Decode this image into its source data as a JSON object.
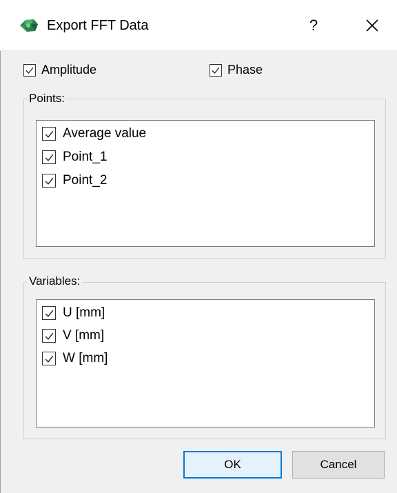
{
  "window": {
    "title": "Export FFT Data",
    "help_label": "?",
    "app_icon": "green-3d-mesh-icon",
    "close_icon": "close-icon"
  },
  "options": {
    "amplitude": {
      "label": "Amplitude",
      "checked": true
    },
    "phase": {
      "label": "Phase",
      "checked": true
    }
  },
  "points": {
    "label": "Points:",
    "items": [
      {
        "label": "Average value",
        "checked": true
      },
      {
        "label": "Point_1",
        "checked": true
      },
      {
        "label": "Point_2",
        "checked": true
      }
    ]
  },
  "variables": {
    "label": "Variables:",
    "items": [
      {
        "label": "U [mm]",
        "checked": true
      },
      {
        "label": "V [mm]",
        "checked": true
      },
      {
        "label": "W [mm]",
        "checked": true
      }
    ]
  },
  "buttons": {
    "ok_label": "OK",
    "cancel_label": "Cancel"
  },
  "colors": {
    "accent": "#0078d7",
    "background": "#f0f0f0"
  }
}
